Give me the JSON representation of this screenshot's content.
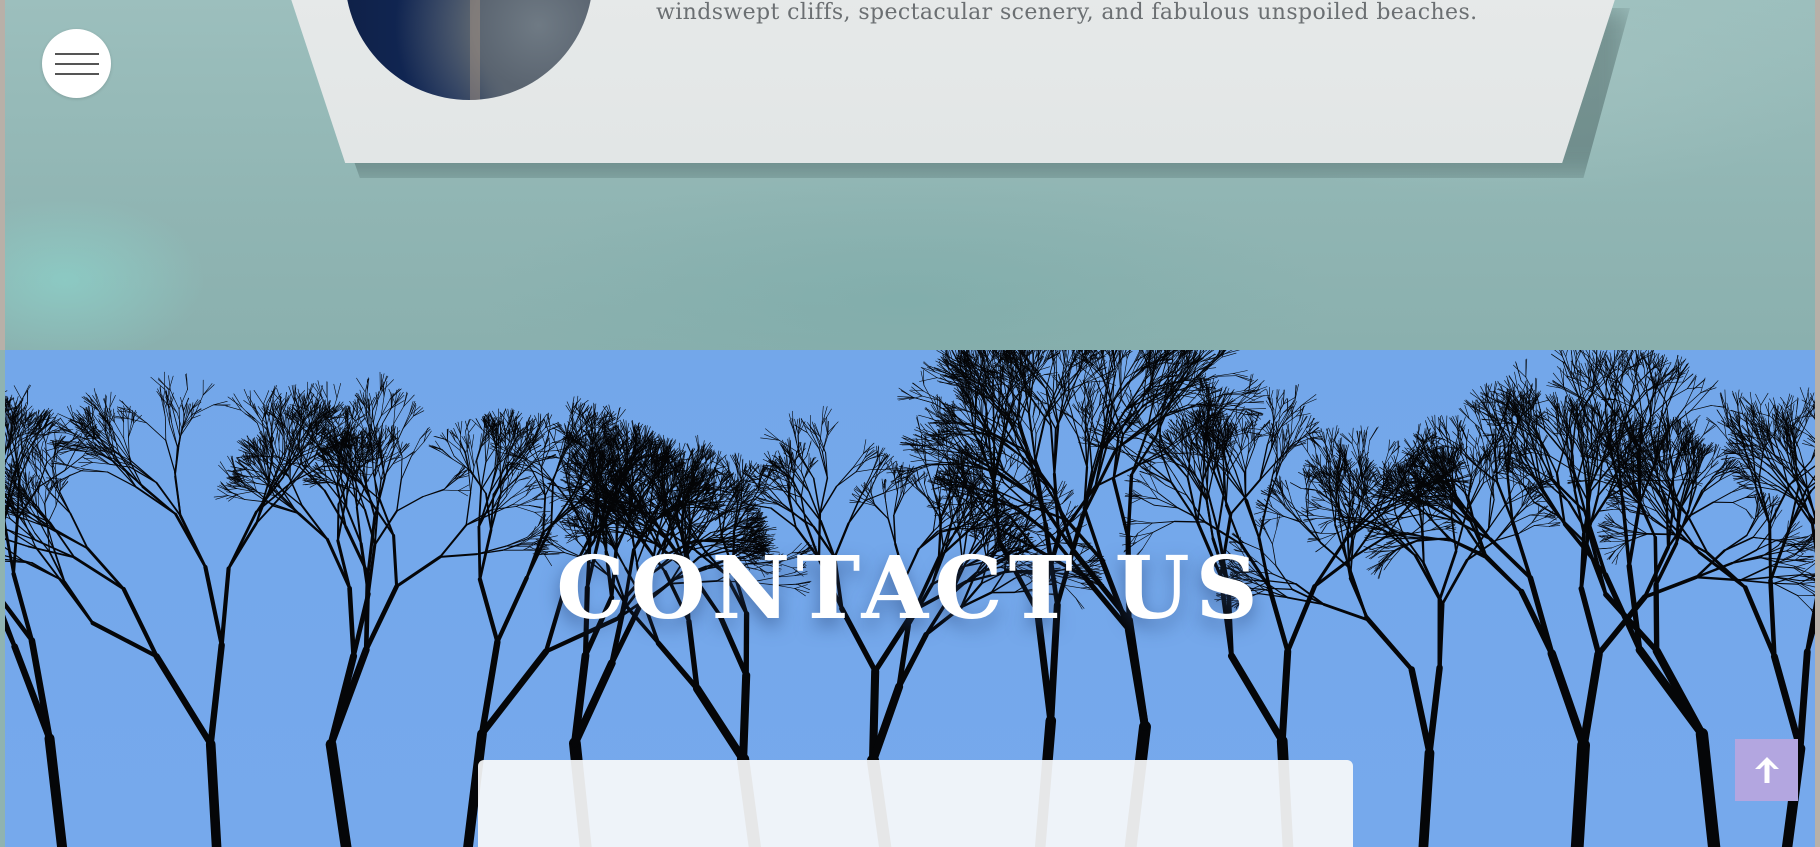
{
  "about": {
    "text": "windswept cliffs, spectacular scenery, and fabulous unspoiled beaches."
  },
  "contact": {
    "title": "CONTACT US"
  },
  "icons": {
    "menu": "hamburger-icon",
    "back_to_top": "arrow-up-icon"
  },
  "colors": {
    "top_background": "#90b5b3",
    "card_background": "#e4e8e8",
    "contact_sky": "#74a8eb",
    "back_to_top": "#b3a6e0",
    "title_text": "#ffffff"
  }
}
